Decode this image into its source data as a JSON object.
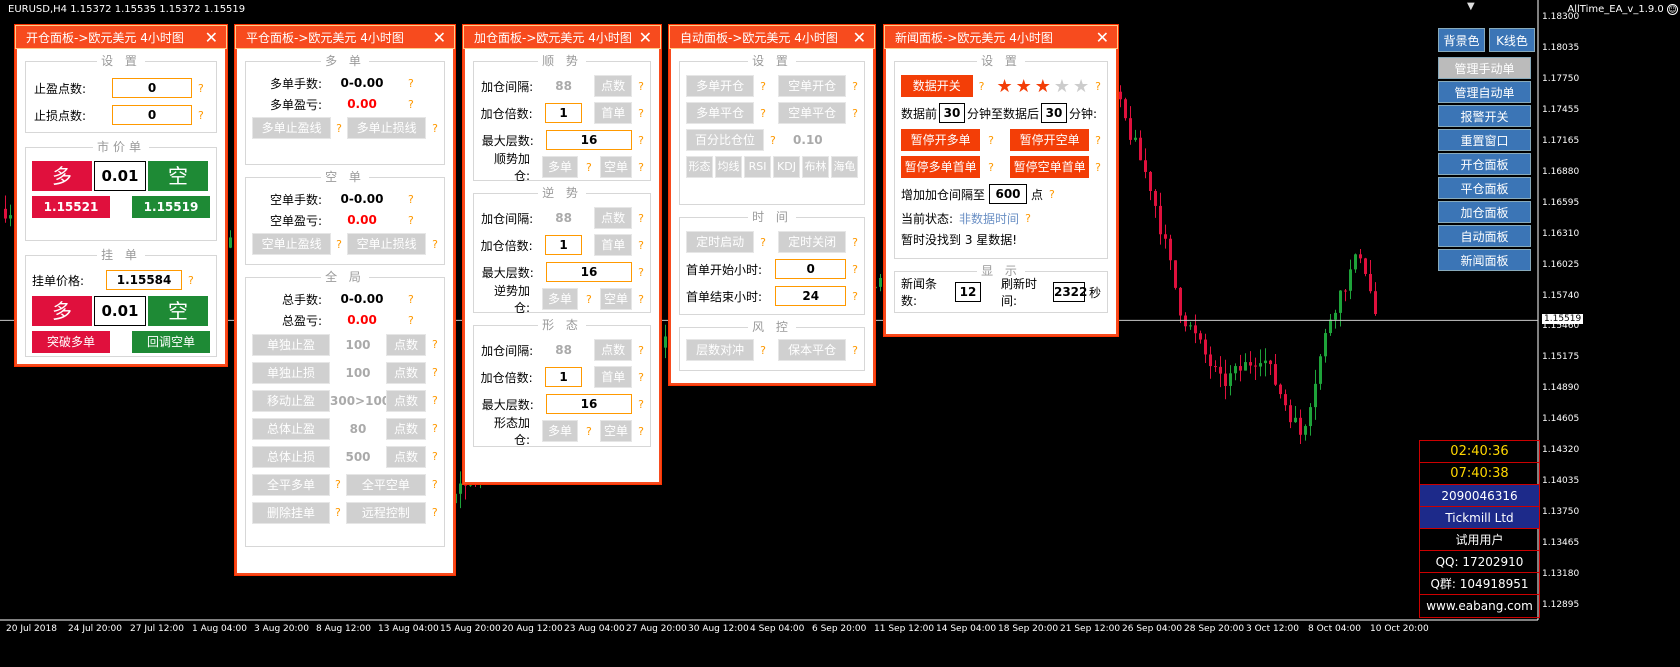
{
  "chart_header": {
    "symbol": "EURUSD,H4  1.15372 1.15535 1.15372 1.15519",
    "ea_name": "AllTime_EA_v_1.9.0",
    "smiley": "☺"
  },
  "chart_data": {
    "type": "candlestick",
    "y_ticks": [
      "1.18300",
      "1.18035",
      "1.17750",
      "1.17455",
      "1.17165",
      "1.16880",
      "1.16595",
      "1.16310",
      "1.16025",
      "1.15740",
      "1.15460",
      "1.15175",
      "1.14890",
      "1.14605",
      "1.14320",
      "1.14035",
      "1.13750",
      "1.13465",
      "1.13180",
      "1.12895"
    ],
    "current_price": "1.15519",
    "x_ticks": [
      "20 Jul 2018",
      "24 Jul 20:00",
      "27 Jul 12:00",
      "1 Aug 04:00",
      "3 Aug 20:00",
      "8 Aug 12:00",
      "13 Aug 04:00",
      "15 Aug 20:00",
      "20 Aug 12:00",
      "23 Aug 04:00",
      "27 Aug 20:00",
      "30 Aug 12:00",
      "4 Sep 04:00",
      "6 Sep 20:00",
      "11 Sep 12:00",
      "14 Sep 04:00",
      "18 Sep 20:00",
      "21 Sep 12:00",
      "26 Sep 04:00",
      "28 Sep 20:00",
      "3 Oct 12:00",
      "8 Oct 04:00",
      "10 Oct 20:00"
    ],
    "ylim": [
      1.1275,
      1.1845
    ],
    "colors": {
      "bull": "#1ea33a",
      "bear": "#e0103d"
    }
  },
  "panel_open": {
    "title": "开仓面板->欧元美元 4小时图",
    "close": "✕",
    "settings_title": "设 置",
    "tp_label": "止盈点数:",
    "tp_value": "0",
    "sl_label": "止损点数:",
    "sl_value": "0",
    "market_title": "市价单",
    "buy": "多",
    "lots": "0.01",
    "sell": "空",
    "bid": "1.15521",
    "ask": "1.15519",
    "pending_title": "挂 单",
    "pending_price_label": "挂单价格:",
    "pending_price": "1.15584",
    "p_buy": "多",
    "p_lots": "0.01",
    "p_sell": "空",
    "breakout_buy": "突破多单",
    "pullback_sell": "回调空单",
    "help": "?"
  },
  "panel_close": {
    "title": "平仓面板->欧元美元 4小时图",
    "long_title": "多 单",
    "long_lots_label": "多单手数:",
    "long_lots": "0-0.00",
    "long_pl_label": "多单盈亏:",
    "long_pl": "0.00",
    "long_tp_line": "多单止盈线",
    "long_sl_line": "多单止损线",
    "short_title": "空 单",
    "short_lots_label": "空单手数:",
    "short_lots": "0-0.00",
    "short_pl_label": "空单盈亏:",
    "short_pl": "0.00",
    "short_tp_line": "空单止盈线",
    "short_sl_line": "空单止损线",
    "all_title": "全 局",
    "total_lots_label": "总手数:",
    "total_lots": "0-0.00",
    "total_pl_label": "总盈亏:",
    "total_pl": "0.00",
    "rows": [
      {
        "btn": "单独止盈",
        "val": "100",
        "unit": "点数"
      },
      {
        "btn": "单独止损",
        "val": "100",
        "unit": "点数"
      },
      {
        "btn": "移动止盈",
        "val": "300>100",
        "unit": "点数"
      },
      {
        "btn": "总体止盈",
        "val": "80",
        "unit": "点数"
      },
      {
        "btn": "总体止损",
        "val": "500",
        "unit": "点数"
      }
    ],
    "close_all_long": "全平多单",
    "close_all_short": "全平空单",
    "delete_pending": "删除挂单",
    "remote": "远程控制"
  },
  "panel_add": {
    "title": "加仓面板->欧元美元 4小时图",
    "sections": [
      {
        "title": "顺 势",
        "interval_label": "加仓间隔:",
        "interval": "88",
        "unit": "点数",
        "mult_label": "加仓倍数:",
        "mult": "1",
        "first": "首单",
        "max_label": "最大层数:",
        "max": "16",
        "mode_label": "顺势加仓:",
        "long": "多单",
        "short": "空单"
      },
      {
        "title": "逆 势",
        "interval_label": "加仓间隔:",
        "interval": "88",
        "unit": "点数",
        "mult_label": "加仓倍数:",
        "mult": "1",
        "first": "首单",
        "max_label": "最大层数:",
        "max": "16",
        "mode_label": "逆势加仓:",
        "long": "多单",
        "short": "空单"
      },
      {
        "title": "形 态",
        "interval_label": "加仓间隔:",
        "interval": "88",
        "unit": "点数",
        "mult_label": "加仓倍数:",
        "mult": "1",
        "first": "首单",
        "max_label": "最大层数:",
        "max": "16",
        "mode_label": "形态加仓:",
        "long": "多单",
        "short": "空单"
      }
    ]
  },
  "panel_auto": {
    "title": "自动面板->欧元美元 4小时图",
    "settings_title": "设 置",
    "long_open": "多单开仓",
    "short_open": "空单开仓",
    "long_close": "多单平仓",
    "short_close": "空单平仓",
    "pct": "百分比仓位",
    "pct_val": "0.10",
    "indicators": [
      "形态",
      "均线",
      "RSI",
      "KDJ",
      "布林",
      "海龟"
    ],
    "time_title": "时 间",
    "timer_on": "定时启动",
    "timer_off": "定时关闭",
    "start_label": "首单开始小时:",
    "start": "0",
    "end_label": "首单结束小时:",
    "end": "24",
    "risk_title": "风 控",
    "hedge": "层数对冲",
    "breakeven": "保本平仓"
  },
  "panel_news": {
    "title": "新闻面板->欧元美元 4小时图",
    "settings_title": "设 置",
    "data_switch": "数据开关",
    "stars": [
      "★",
      "★",
      "★",
      "★",
      "★"
    ],
    "stars_filled": 3,
    "pre_label": "数据前",
    "pre": "30",
    "mid_label": "分钟至数据后",
    "post": "30",
    "post_label": "分钟:",
    "pause_long": "暂停开多单",
    "pause_short": "暂停开空单",
    "pause_long_first": "暂停多单首单",
    "pause_short_first": "暂停空单首单",
    "increase_label": "增加加仓间隔至",
    "increase": "600",
    "increase_unit": "点",
    "status_label": "当前状态:",
    "status": "非数据时间",
    "msg": "暂时没找到 3 星数据!",
    "display_title": "显 示",
    "count_label": "新闻条数:",
    "count": "12",
    "refresh_label": "刷新时间:",
    "refresh": "2322",
    "refresh_unit": "秒"
  },
  "side_buttons": {
    "bg": "背景色",
    "kline": "K线色",
    "items": [
      "管理手动单",
      "管理自动单",
      "报警开关",
      "重置窗口",
      "开仓面板",
      "平仓面板",
      "加仓面板",
      "自动面板",
      "新闻面板"
    ]
  },
  "info": {
    "time1": "02:40:36",
    "time2": "07:40:38",
    "account": "2090046316",
    "broker": "Tickmill Ltd",
    "user": "试用用户",
    "qq": "QQ:  17202910",
    "qgroup": "Q群:  104918951",
    "site": "www.eabang.com"
  }
}
